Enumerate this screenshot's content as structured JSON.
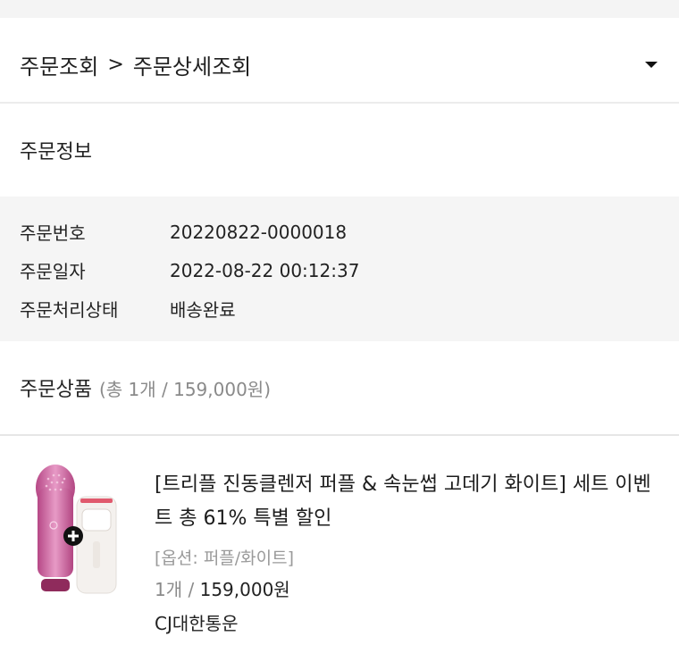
{
  "breadcrumb": {
    "first": "주문조회",
    "separator": ">",
    "second": "주문상세조회"
  },
  "order_info": {
    "title": "주문정보",
    "rows": [
      {
        "label": "주문번호",
        "value": "20220822-0000018"
      },
      {
        "label": "주문일자",
        "value": "2022-08-22 00:12:37"
      },
      {
        "label": "주문처리상태",
        "value": "배송완료"
      }
    ]
  },
  "products": {
    "title": "주문상품",
    "summary": "(총 1개 / 159,000원)",
    "items": [
      {
        "name": "[트리플 진동클렌저 퍼플 & 속눈썹 고데기 화이트] 세트 이벤트 총 61% 특별 할인",
        "option": "[옵션: 퍼플/화이트]",
        "quantity": "1개 /",
        "price": "159,000원",
        "carrier": "CJ대한통운"
      }
    ]
  },
  "colors": {
    "accent_pink": "#c75a9a",
    "section_bg": "#f5f5f5"
  },
  "icons": {
    "dropdown": "caret-down-icon",
    "plus": "plus-circle-icon"
  }
}
